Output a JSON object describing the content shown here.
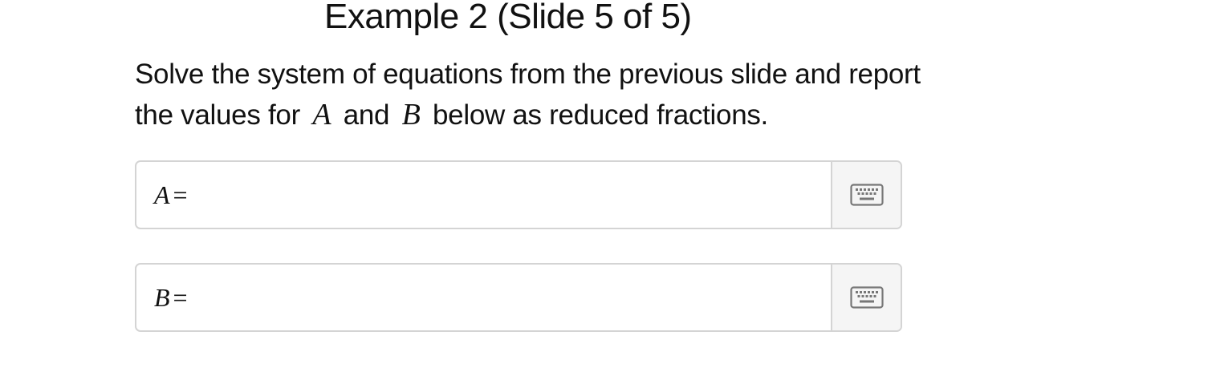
{
  "title": "Example 2 (Slide 5 of 5)",
  "instructions": {
    "part1": "Solve the system of equations from the previous slide and report the values for",
    "var_a": "A",
    "part2": "and",
    "var_b": "B",
    "part3": "below as reduced fractions."
  },
  "answers": [
    {
      "variable": "A",
      "equals": "=",
      "value": "",
      "keyboard_icon": "keyboard-icon"
    },
    {
      "variable": "B",
      "equals": "=",
      "value": "",
      "keyboard_icon": "keyboard-icon"
    }
  ]
}
